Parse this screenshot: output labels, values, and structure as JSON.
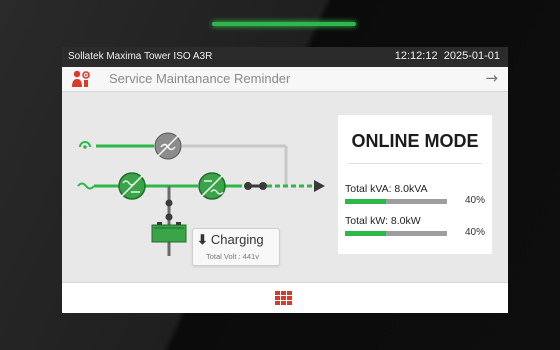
{
  "device": {
    "model": "Sollatek Maxima Tower ISO A3R",
    "time": "12:12:12",
    "date": "2025-01-01",
    "led_color": "#2fb84a"
  },
  "reminder": {
    "text": "Service Maintanance Reminder",
    "icon": "service-wrench-icon",
    "arrow": "→"
  },
  "diagram": {
    "nodes": [
      "bypass-input-icon",
      "mains-input-icon",
      "bypass-converter-icon",
      "rectifier-icon",
      "inverter-icon",
      "output-switch-icon",
      "battery-icon",
      "output-arrow-icon"
    ],
    "active_color": "#2fb84a",
    "inactive_color": "#c8c8c8"
  },
  "charging": {
    "icon": "⬇",
    "label": "Charging",
    "volt_text": "Total Volt : 441v"
  },
  "mode": {
    "title": "ONLINE MODE",
    "kva": {
      "label": "Total kVA: 8.0kVA",
      "percent_text": "40%",
      "value": 0.4
    },
    "kw": {
      "label": "Total kW: 8.0kW",
      "percent_text": "40%",
      "value": 0.4
    }
  },
  "bottom": {
    "menu_icon": "menu-grid-icon",
    "menu_color": "#d93b2b"
  }
}
